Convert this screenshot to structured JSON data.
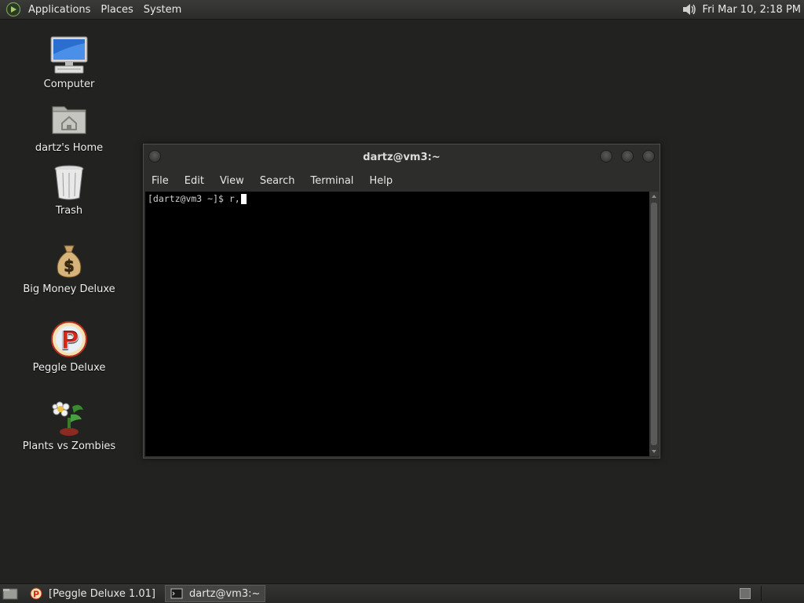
{
  "top_panel": {
    "menus": [
      "Applications",
      "Places",
      "System"
    ],
    "clock": "Fri Mar 10,  2:18 PM"
  },
  "desktop_icons": [
    {
      "label": "Computer",
      "icon": "computer-icon"
    },
    {
      "label": "dartz's Home",
      "icon": "home-folder-icon"
    },
    {
      "label": "Trash",
      "icon": "trash-icon"
    },
    {
      "label": "Big Money Deluxe",
      "icon": "money-bag-icon"
    },
    {
      "label": "Peggle Deluxe",
      "icon": "peggle-icon"
    },
    {
      "label": "Plants vs Zombies",
      "icon": "plants-vs-zombies-icon"
    }
  ],
  "terminal": {
    "title": "dartz@vm3:~",
    "menu": [
      "File",
      "Edit",
      "View",
      "Search",
      "Terminal",
      "Help"
    ],
    "prompt": "[dartz@vm3 ~]$ r,"
  },
  "taskbar": {
    "tasks": [
      {
        "label": "[Peggle Deluxe 1.01]",
        "icon": "peggle-icon",
        "active": false
      },
      {
        "label": "dartz@vm3:~",
        "icon": "terminal-icon",
        "active": true
      }
    ]
  },
  "colors": {
    "desktop_bg": "#222321",
    "panel_bg": "#2c2d2b",
    "terminal_bg": "#000000"
  }
}
